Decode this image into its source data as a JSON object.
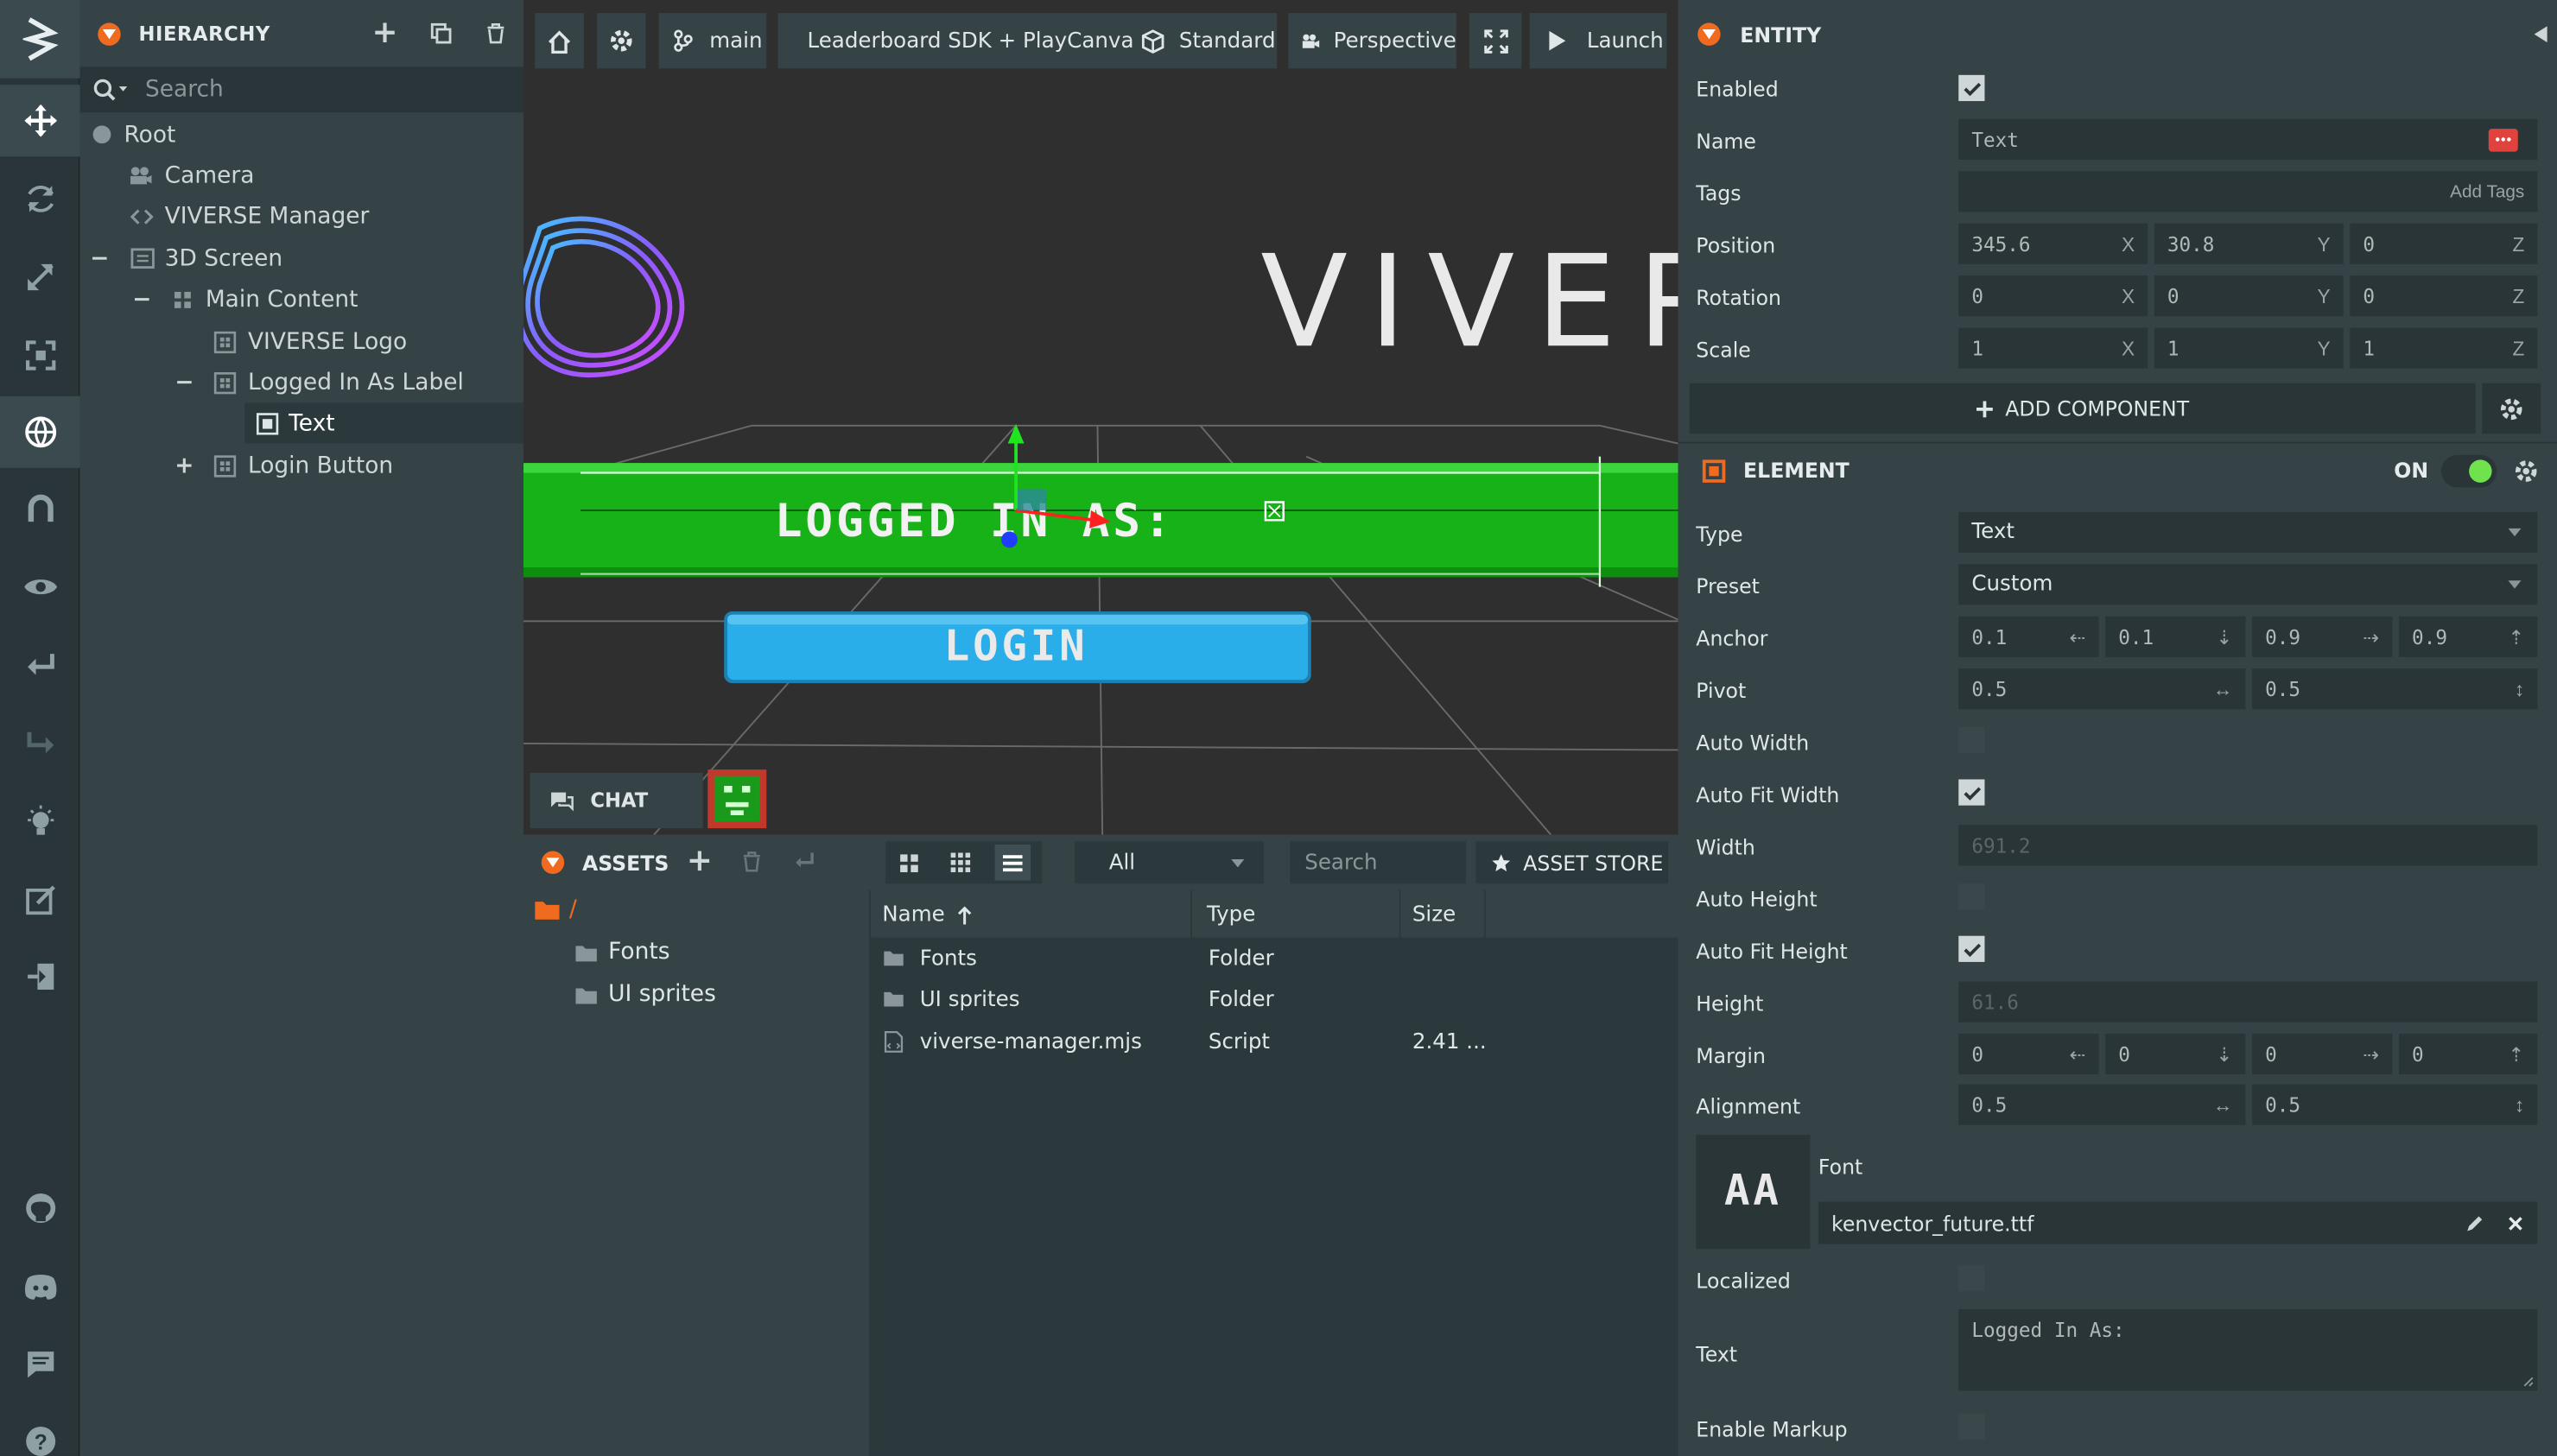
{
  "toolbar": {
    "tools": [
      "logo-icon",
      "translate-icon",
      "rotate-icon",
      "scale-icon",
      "resize-element-icon",
      "world-space-icon",
      "snap-icon",
      "focus-icon",
      "undo-icon",
      "redo-icon",
      "bake-lighting-icon",
      "code-editor-icon",
      "publish-icon"
    ],
    "bottom": [
      "github-icon",
      "discord-icon",
      "feedback-icon",
      "help-icon"
    ]
  },
  "hierarchy": {
    "title": "HIERARCHY",
    "search_placeholder": "Search",
    "items": [
      {
        "label": "Root"
      },
      {
        "label": "Camera"
      },
      {
        "label": "VIVERSE Manager"
      },
      {
        "label": "3D Screen"
      },
      {
        "label": "Main Content"
      },
      {
        "label": "VIVERSE Logo"
      },
      {
        "label": "Logged In As Label"
      },
      {
        "label": "Text"
      },
      {
        "label": "Login Button"
      }
    ]
  },
  "viewport": {
    "branch": "main",
    "scene_name": "Leaderboard SDK + PlayCanvas UI",
    "render_mode": "Standard",
    "camera": "Perspective",
    "launch": "Launch",
    "logo_text": "VIVERSE",
    "label_text": "LOGGED IN AS:",
    "button_text": "LOGIN",
    "chat_label": "CHAT"
  },
  "assets": {
    "title": "ASSETS",
    "filter": "All",
    "search_placeholder": "Search",
    "store": "ASSET STORE",
    "root_folder": "/",
    "tree": [
      {
        "label": "Fonts"
      },
      {
        "label": "UI sprites"
      }
    ],
    "columns": {
      "name": "Name",
      "type": "Type",
      "size": "Size"
    },
    "rows": [
      {
        "name": "Fonts",
        "type": "Folder",
        "size": ""
      },
      {
        "name": "UI sprites",
        "type": "Folder",
        "size": ""
      },
      {
        "name": "viverse-manager.mjs",
        "type": "Script",
        "size": "2.41 ..."
      }
    ]
  },
  "inspector": {
    "entity_title": "ENTITY",
    "enabled_label": "Enabled",
    "name_label": "Name",
    "name_value": "Text",
    "tags_label": "Tags",
    "tags_placeholder": "Add Tags",
    "position_label": "Position",
    "position": [
      "345.6",
      "30.8",
      "0"
    ],
    "rotation_label": "Rotation",
    "rotation": [
      "0",
      "0",
      "0"
    ],
    "scale_label": "Scale",
    "scale": [
      "1",
      "1",
      "1"
    ],
    "axes": [
      "X",
      "Y",
      "Z"
    ],
    "add_component": "ADD COMPONENT",
    "element_title": "ELEMENT",
    "element_on": "ON",
    "type_label": "Type",
    "type_value": "Text",
    "preset_label": "Preset",
    "preset_value": "Custom",
    "anchor_label": "Anchor",
    "anchor": [
      "0.1",
      "0.1",
      "0.9",
      "0.9"
    ],
    "pivot_label": "Pivot",
    "pivot": [
      "0.5",
      "0.5"
    ],
    "auto_width_label": "Auto Width",
    "auto_fit_width_label": "Auto Fit Width",
    "width_label": "Width",
    "width_value": "691.2",
    "auto_height_label": "Auto Height",
    "auto_fit_height_label": "Auto Fit Height",
    "height_label": "Height",
    "height_value": "61.6",
    "margin_label": "Margin",
    "margin": [
      "0",
      "0",
      "0",
      "0"
    ],
    "alignment_label": "Alignment",
    "alignment": [
      "0.5",
      "0.5"
    ],
    "font_label": "Font",
    "font_preview": "AA",
    "font_value": "kenvector_future.ttf",
    "localized_label": "Localized",
    "text_label": "Text",
    "text_value": "Logged In As:",
    "enable_markup_label": "Enable Markup"
  },
  "colors": {
    "accent_orange": "#f06b1f",
    "green_plane": "#17b217",
    "login_blue": "#2aaeea",
    "toggle_green": "#6fe24d"
  }
}
